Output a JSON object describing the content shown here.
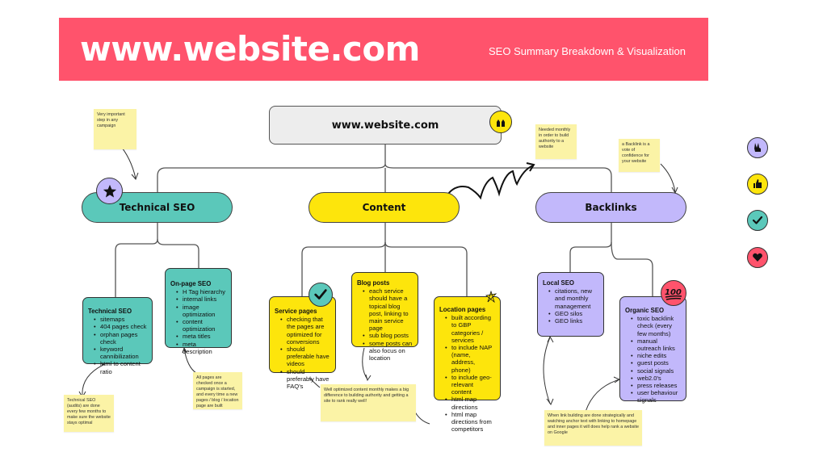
{
  "banner": {
    "title": "www.website.com",
    "subtitle": "SEO Summary Breakdown & Visualization",
    "color": "#ff536c"
  },
  "root": {
    "label": "www.website.com",
    "icon": "raised-hands-icon"
  },
  "branches": {
    "technical": {
      "label": "Technical SEO",
      "color": "#5bc8ba",
      "icon": "star-icon"
    },
    "content": {
      "label": "Content",
      "color": "#fde50c"
    },
    "backlinks": {
      "label": "Backlinks",
      "color": "#c2b8fb"
    }
  },
  "cards": {
    "technical_seo": {
      "title": "Technical SEO",
      "items": [
        "sitemaps",
        "404 pages check",
        "orphan pages check",
        "keyword cannibilization",
        "html to content ratio"
      ]
    },
    "onpage_seo": {
      "title": "On-page SEO",
      "items": [
        "H Tag hierarchy",
        "internal links",
        "image optimization",
        "content optimization",
        "meta titles",
        "meta description"
      ]
    },
    "service_pages": {
      "title": "Service pages",
      "items": [
        "checking that the pages are optimized for conversions",
        "should preferable have videos",
        "should preferably have FAQ's"
      ],
      "icon": "checkmark-icon"
    },
    "blog_posts": {
      "title": "Blog posts",
      "items": [
        "each service should have a topical blog post, linking to main service page",
        "sub blog posts",
        "some posts can also focus on location"
      ]
    },
    "location_pages": {
      "title": "Location pages",
      "items": [
        "built according to GBP categories / services",
        "to include NAP (name, address, phone)",
        "to include geo-relevant content",
        "html map directions",
        "html map directions from competitors"
      ],
      "icon": "sparkle-icon"
    },
    "local_seo": {
      "title": "Local SEO",
      "items": [
        "citations, new and monthly management",
        "GEO silos",
        "GEO links"
      ]
    },
    "organic_seo": {
      "title": "Organic SEO",
      "items": [
        "toxic backlink check (every few months)",
        "manual outreach links",
        "niche edits",
        "guest posts",
        "social signals",
        "web2.0's",
        "press releases",
        "user behaviour signals"
      ],
      "icon": "hundred-points-icon"
    }
  },
  "notes": {
    "important_step": "Very important step in any campaign",
    "needed_monthly": "Needed monthly in order to build authority to a website",
    "backlink_vote": "a Backlink is a vote of confidence for your website",
    "technical_audits": "Technical SEO (audits) are done every few months to make sure the website stays optimal",
    "pages_checked": "All pages are checked once a campaign is started, and every time a new pages / blog / location page are built",
    "well_optimized": "Well optimized content  monthly makes a big difference to building authority and getting a site to rank really well!",
    "link_building": "When link building are done strategically and watching anchor text with linking to homepage and inner pages it will does help rank a website on Google"
  },
  "reaction_icons": [
    {
      "name": "victory-hand-icon",
      "color": "#c2b8fb"
    },
    {
      "name": "thumbs-up-icon",
      "color": "#fde50c"
    },
    {
      "name": "checkmark-icon",
      "color": "#5bc8ba"
    },
    {
      "name": "heart-icon",
      "color": "#ff536c"
    }
  ]
}
